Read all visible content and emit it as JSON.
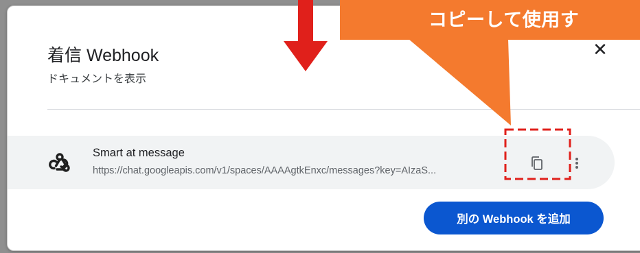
{
  "dialog": {
    "title": "着信 Webhook",
    "docs_link": "ドキュメントを表示",
    "close_glyph": "✕"
  },
  "webhook": {
    "name": "Smart at message",
    "url": "https://chat.googleapis.com/v1/spaces/AAAAgtkEnxc/messages?key=AIzaS...",
    "icon": "webhook-icon"
  },
  "actions": {
    "add_label": "別の Webhook を追加"
  },
  "annotation": {
    "callout_text": "コピーして使用す",
    "callout_color": "#f47a2e",
    "arrow_color": "#e0201b",
    "highlight_color": "#e0201b"
  },
  "colors": {
    "accent": "#0b57d0",
    "row_bg": "#f1f3f4"
  }
}
